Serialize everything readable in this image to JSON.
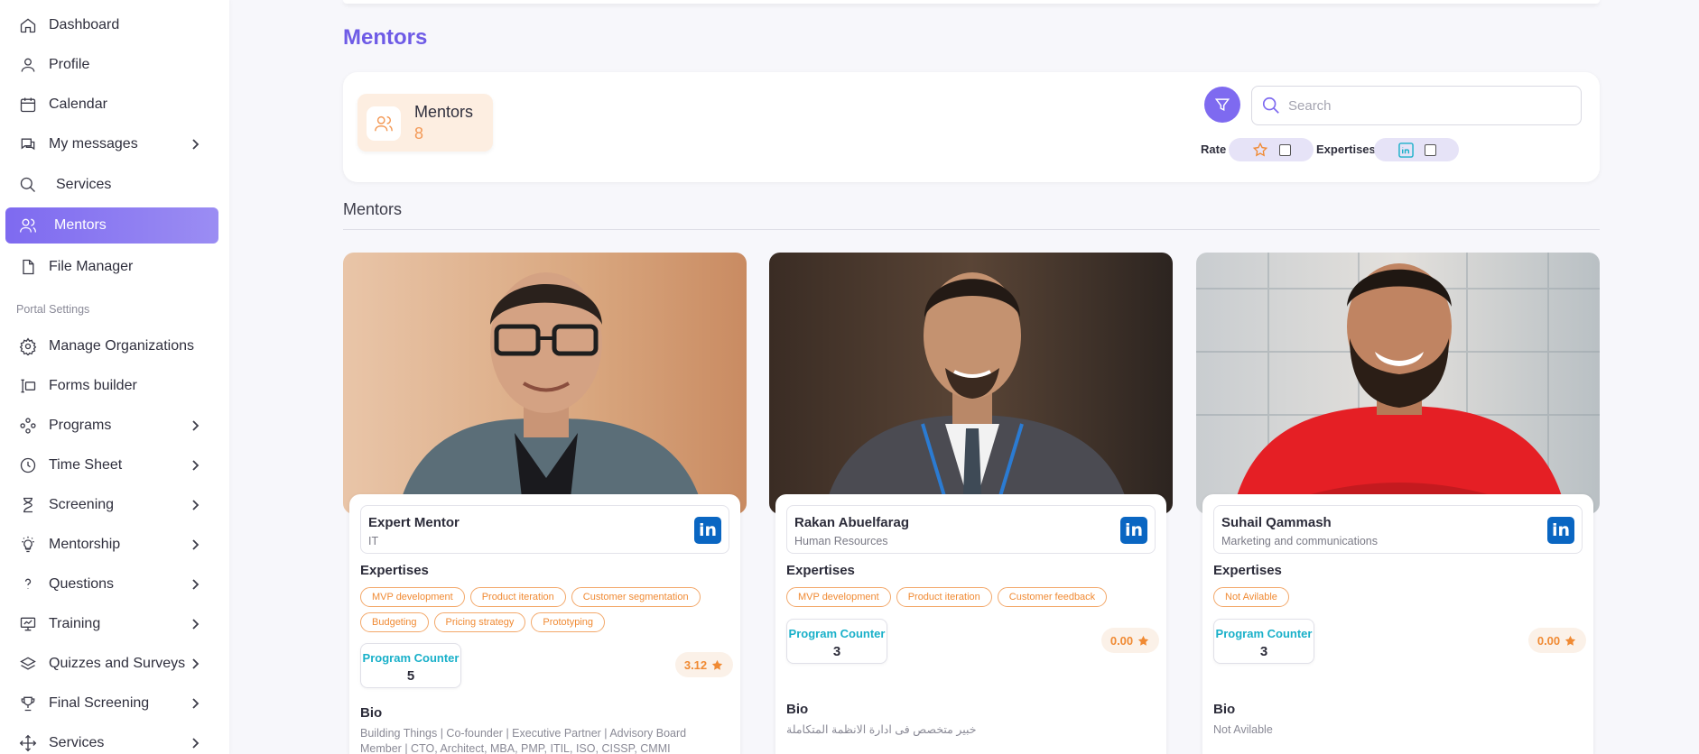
{
  "sidebar": {
    "items": [
      {
        "label": "Dashboard",
        "icon": "home-icon"
      },
      {
        "label": "Profile",
        "icon": "user-icon"
      },
      {
        "label": "Calendar",
        "icon": "calendar-icon"
      },
      {
        "label": "My messages",
        "icon": "chat-icon"
      },
      {
        "label": "Services",
        "icon": "search-icon"
      },
      {
        "label": "Mentors",
        "icon": "users-icon"
      },
      {
        "label": "File Manager",
        "icon": "file-icon"
      },
      {
        "label": "Manage Organizations",
        "icon": "gear-icon"
      },
      {
        "label": "Forms builder",
        "icon": "form-icon"
      },
      {
        "label": "Programs",
        "icon": "programs-icon"
      },
      {
        "label": "Time Sheet",
        "icon": "clock-icon"
      },
      {
        "label": "Screening",
        "icon": "hourglass-icon"
      },
      {
        "label": "Mentorship",
        "icon": "bulb-icon"
      },
      {
        "label": "Questions",
        "icon": "question-icon"
      },
      {
        "label": "Training",
        "icon": "presentation-icon"
      },
      {
        "label": "Quizzes and Surveys",
        "icon": "layers-icon"
      },
      {
        "label": "Final Screening",
        "icon": "trophy-icon"
      },
      {
        "label": "Services",
        "icon": "move-icon"
      }
    ],
    "section_label": "Portal Settings",
    "active_color": "#7e6af0"
  },
  "page": {
    "title": "Mentors",
    "subtitle": "Mentors"
  },
  "stat": {
    "label": "Mentors",
    "count": "8"
  },
  "filters": {
    "search_placeholder": "Search",
    "rate_label": "Rate",
    "expertises_label": "Expertises"
  },
  "labels": {
    "expertises": "Expertises",
    "program_counter": "Program Counter",
    "bio": "Bio",
    "linkedin": "in"
  },
  "mentors": [
    {
      "name": "Expert Mentor",
      "department": "IT",
      "tags": [
        "MVP development",
        "Product iteration",
        "Customer segmentation",
        "Budgeting",
        "Pricing strategy",
        "Prototyping"
      ],
      "program_counter": "5",
      "rating": "3.12",
      "bio": "Building Things | Co-founder | Executive Partner | Advisory Board Member | CTO, Architect, MBA, PMP, ITIL, ISO, CISSP, CMMI"
    },
    {
      "name": "Rakan Abuelfarag",
      "department": "Human Resources",
      "tags": [
        "MVP development",
        "Product iteration",
        "Customer feedback"
      ],
      "program_counter": "3",
      "rating": "0.00",
      "bio": "خبير متخصص فى ادارة الانظمة المتكاملة"
    },
    {
      "name": "Suhail Qammash",
      "department": "Marketing and communications",
      "tags": [
        "Not Avilable"
      ],
      "program_counter": "3",
      "rating": "0.00",
      "bio": "Not Avilable"
    }
  ],
  "colors": {
    "accent": "#7e6af0",
    "title": "#6e5be6",
    "orange": "#f08a33",
    "teal": "#19b0c9",
    "linkedin": "#0a66c2"
  }
}
